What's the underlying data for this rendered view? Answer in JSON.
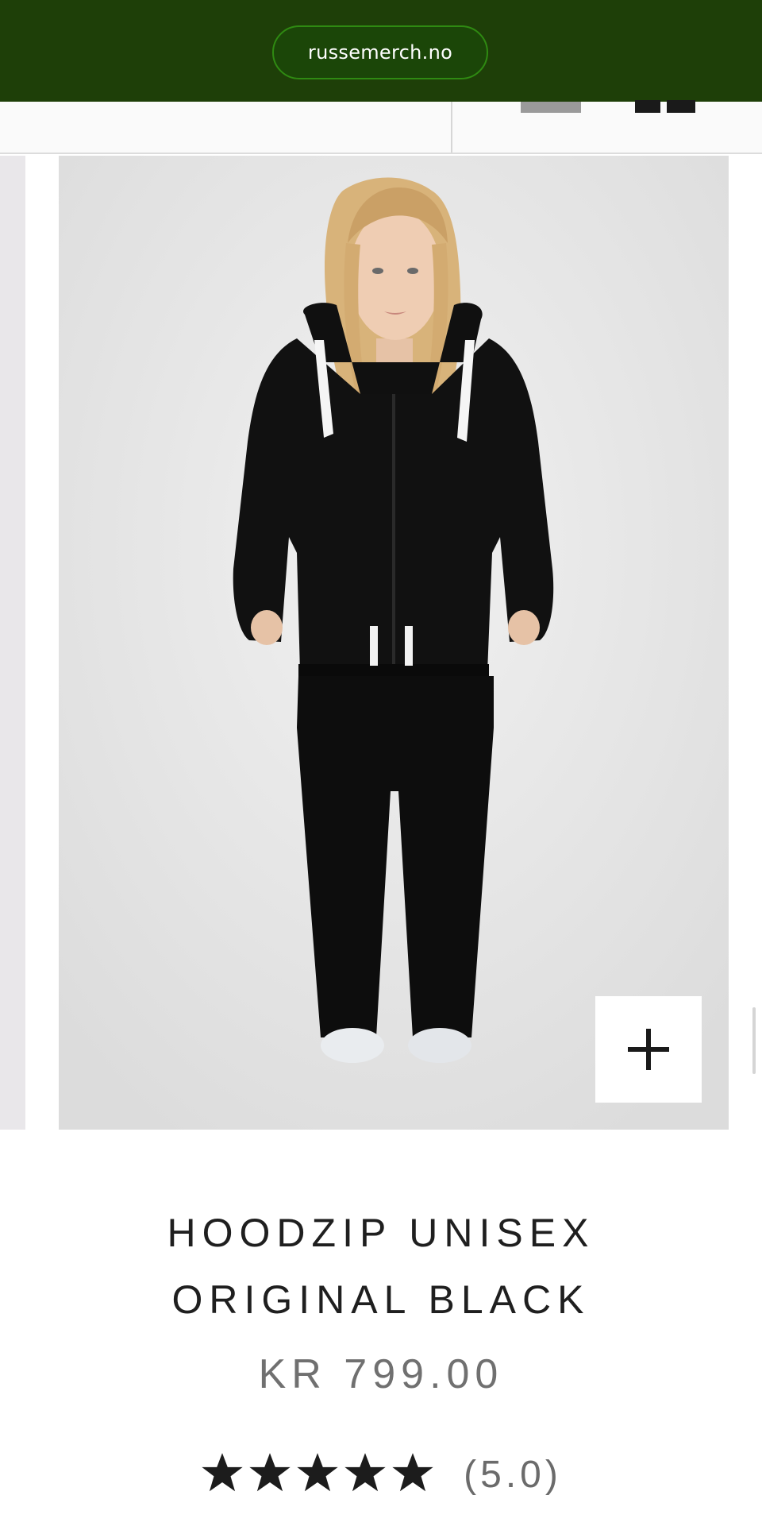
{
  "browser": {
    "url": "russemerch.no"
  },
  "product": {
    "title_line1": "HOODZIP UNISEX",
    "title_line2": "ORIGINAL BLACK",
    "price": "KR 799.00",
    "rating": {
      "value": 5,
      "max": 5,
      "label": "(5.0)"
    }
  },
  "gallery": {
    "main_image": "model-wearing-black-hoodie-and-sweatpants",
    "zoom_icon": "plus-icon"
  },
  "colors": {
    "topbar": "#1e3f08",
    "pill": "#1b4608",
    "pill_border": "#2f8a12",
    "price_text": "#707070"
  }
}
